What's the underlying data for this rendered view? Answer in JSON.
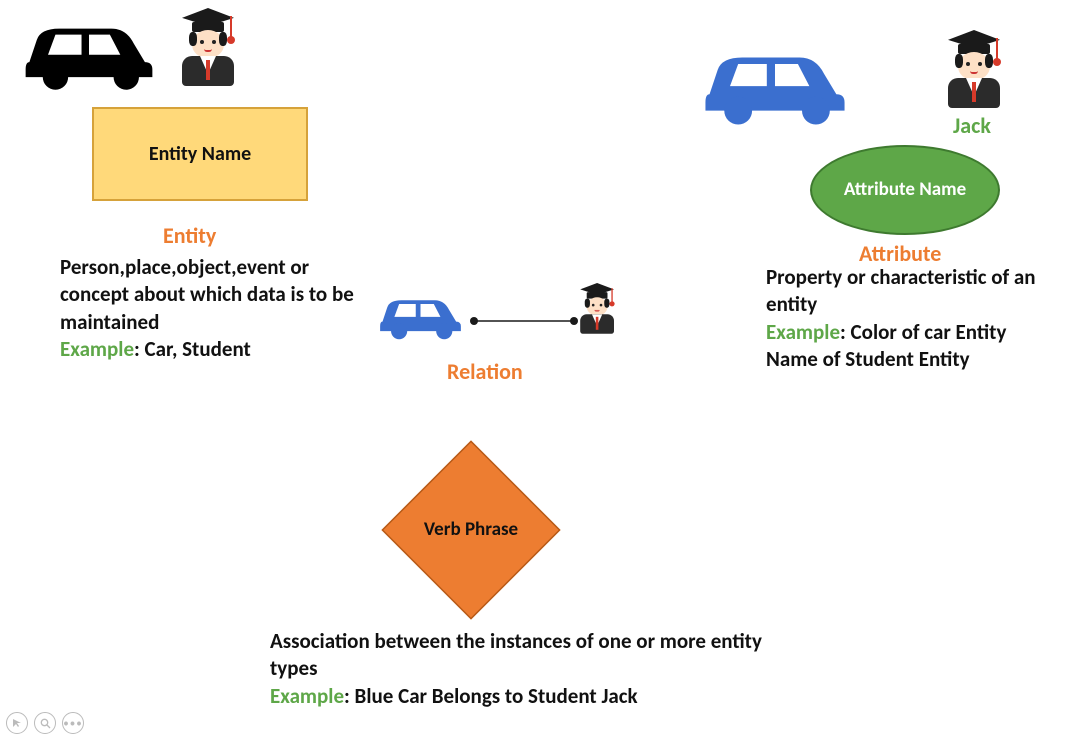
{
  "entity": {
    "box_label": "Entity Name",
    "title": "Entity",
    "desc": "Person,place,object,event or concept about which data is to be maintained",
    "example_label": "Example",
    "example_text": ": Car, Student"
  },
  "attribute": {
    "name_caption": "Jack",
    "ellipse_label": "Attribute Name",
    "title": "Attribute",
    "desc": "Property or characteristic of an entity",
    "example_label": "Example",
    "example_text_l1": ": Color of car Entity",
    "example_text_l2": "Name of Student Entity"
  },
  "relation": {
    "title": "Relation",
    "diamond_label": "Verb Phrase",
    "desc": "Association between the instances of one or more entity types",
    "example_label": "Example",
    "example_text": ": Blue Car Belongs to Student Jack"
  },
  "icons": {
    "car_black": "car-icon",
    "car_blue": "car-icon",
    "graduate": "graduate-icon"
  },
  "colors": {
    "orange": "#ed7d31",
    "green": "#5ea748",
    "entity_fill": "#ffd97a",
    "car_blue": "#3b6fcf",
    "car_black": "#000000"
  }
}
